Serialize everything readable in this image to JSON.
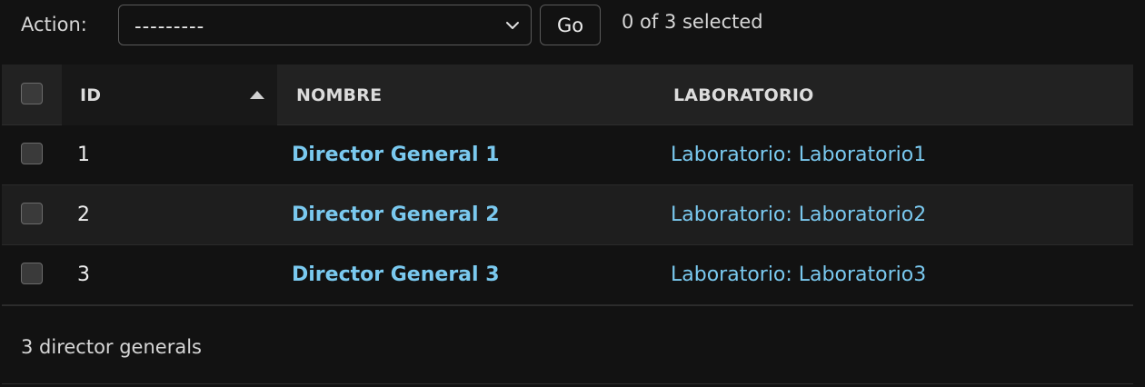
{
  "actions": {
    "label": "Action:",
    "selected_option": "---------",
    "go_label": "Go",
    "selection_counter": "0 of 3 selected"
  },
  "table": {
    "columns": [
      "ID",
      "NOMBRE",
      "LABORATORIO"
    ],
    "sort": {
      "column": "ID",
      "direction": "ascending"
    },
    "rows": [
      {
        "id": "1",
        "nombre": "Director General 1",
        "laboratorio": "Laboratorio: Laboratorio1"
      },
      {
        "id": "2",
        "nombre": "Director General 2",
        "laboratorio": "Laboratorio: Laboratorio2"
      },
      {
        "id": "3",
        "nombre": "Director General 3",
        "laboratorio": "Laboratorio: Laboratorio3"
      }
    ]
  },
  "paginator": {
    "text": "3 director generals"
  },
  "colors": {
    "background": "#121212",
    "header_background": "#222222",
    "link": "#7ac9ef"
  },
  "icons": {
    "select_chevron": "chevron-down-icon",
    "sort": "sort-ascending-icon"
  }
}
